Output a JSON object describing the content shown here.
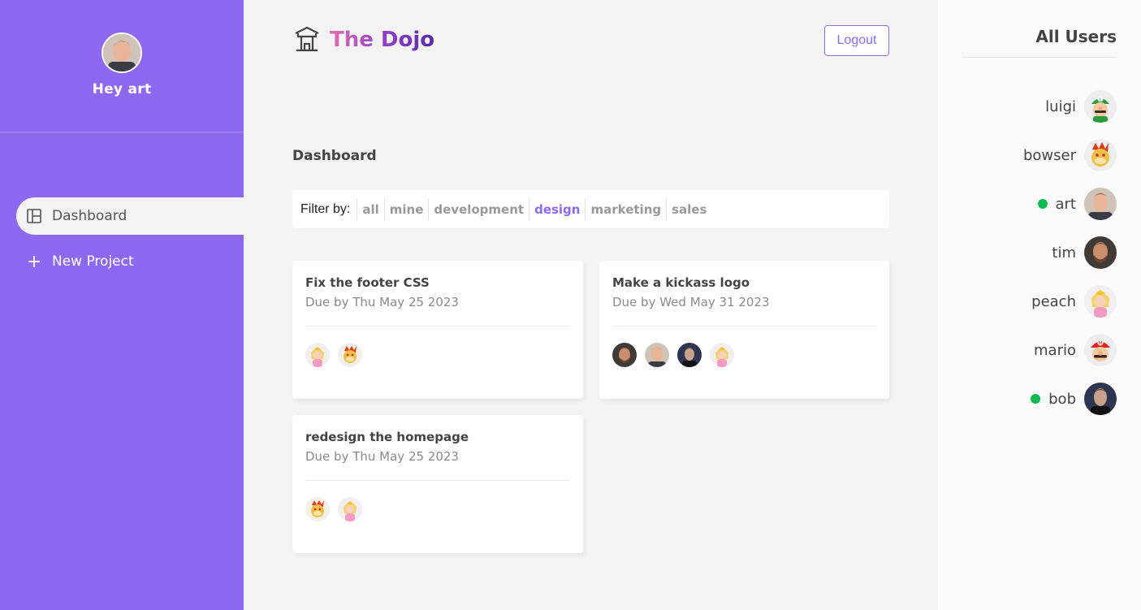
{
  "sidebar": {
    "greeting": "Hey art",
    "avatar": "art-avatar",
    "nav": [
      {
        "label": "Dashboard",
        "icon": "dashboard-icon",
        "active": true
      },
      {
        "label": "New Project",
        "icon": "plus-icon",
        "active": false
      }
    ]
  },
  "header": {
    "brand": "The Dojo",
    "brand_icon": "temple-icon",
    "logout_label": "Logout"
  },
  "main": {
    "title": "Dashboard",
    "filter": {
      "label": "Filter by:",
      "options": [
        "all",
        "mine",
        "development",
        "design",
        "marketing",
        "sales"
      ],
      "active": "design"
    },
    "projects": [
      {
        "title": "Fix the footer CSS",
        "due": "Due by Thu May 25 2023",
        "assigned": [
          "peach",
          "bowser"
        ]
      },
      {
        "title": "Make a kickass logo",
        "due": "Due by Wed May 31 2023",
        "assigned": [
          "tim",
          "art",
          "bob",
          "peach"
        ]
      },
      {
        "title": "redesign the homepage",
        "due": "Due by Thu May 25 2023",
        "assigned": [
          "bowser",
          "peach"
        ]
      }
    ]
  },
  "users": {
    "title": "All Users",
    "list": [
      {
        "name": "luigi",
        "online": false
      },
      {
        "name": "bowser",
        "online": false
      },
      {
        "name": "art",
        "online": true
      },
      {
        "name": "tim",
        "online": false
      },
      {
        "name": "peach",
        "online": false
      },
      {
        "name": "mario",
        "online": false
      },
      {
        "name": "bob",
        "online": true
      }
    ]
  },
  "colors": {
    "accent": "#8d69f1",
    "online": "#0ebb50",
    "background": "#f4f4f4"
  }
}
